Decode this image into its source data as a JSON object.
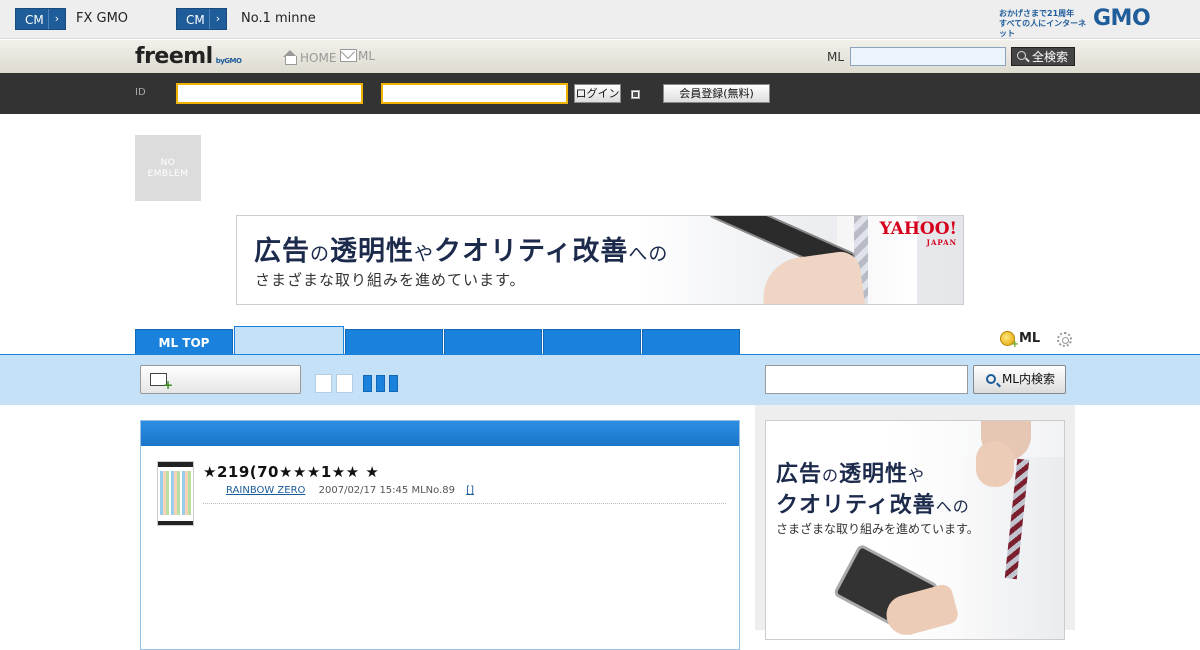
{
  "gmo_bar": {
    "cm1_label": "CM",
    "cm1_text": "FX GMO",
    "cm2_label": "CM",
    "cm2_text": "No.1 minne",
    "tagline_1": "おかげさまで21周年",
    "tagline_2": "すべての人にインターネット",
    "logo": "GMO"
  },
  "header": {
    "logo_main": "freeml",
    "logo_by": "byGMO",
    "home_link": "HOME",
    "ml_link": "ML",
    "search_label": "ML",
    "search_placeholder": "",
    "search_button": "全検索"
  },
  "login": {
    "id_label": "ID",
    "id_value": "",
    "password_value": "",
    "login_button": "ログイン",
    "register_button": "会員登録(無料)"
  },
  "emblem": {
    "line1": "NO",
    "line2": "EMBLEM"
  },
  "ad_banner": {
    "line1_a": "広告",
    "line1_b": "の",
    "line1_c": "透明性",
    "line1_d": "や",
    "line1_e": "クオリティ改善",
    "line1_f": "への",
    "line2": "さまざまな取り組みを進めています。",
    "brand": "YAHOO!",
    "brand_sub": "JAPAN"
  },
  "tabs": [
    {
      "label": "ML TOP"
    },
    {
      "label": ""
    },
    {
      "label": ""
    },
    {
      "label": ""
    },
    {
      "label": ""
    },
    {
      "label": ""
    }
  ],
  "tab_actions": {
    "ml_create": "ML"
  },
  "toolbar": {
    "post_button": "",
    "inner_search_value": "",
    "inner_search_button": "ML内検索"
  },
  "post": {
    "title": "★219(70★★★1★★ ★",
    "author": "RAINBOW ZERO",
    "date": "2007/02/17 15:45",
    "ml_no": "MLNo.89",
    "reply": "[]"
  },
  "side_ad": {
    "l1_a": "広告",
    "l1_b": "の",
    "l1_c": "透明性",
    "l1_d": "や",
    "l2_a": "クオリティ改善",
    "l2_b": "への",
    "l3": "さまざまな取り組みを進めています。"
  },
  "colors": {
    "accent_blue": "#1a82dc",
    "gmo_blue": "#1e5c9a",
    "toolbar_bg": "#c4e1f8",
    "login_bar": "#333333",
    "input_border": "#f0b400"
  }
}
